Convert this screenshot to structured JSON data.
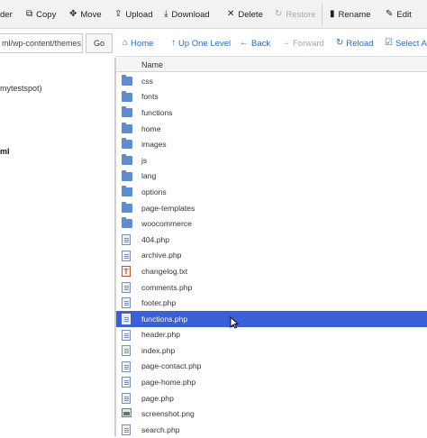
{
  "toolbar": {
    "items": [
      {
        "label": "der",
        "icon": "folder-icon",
        "enabled": true
      },
      {
        "label": "Copy",
        "icon": "copy-icon",
        "enabled": true
      },
      {
        "label": "Move",
        "icon": "move-icon",
        "enabled": true
      },
      {
        "label": "Upload",
        "icon": "upload-icon",
        "enabled": true
      },
      {
        "label": "Download",
        "icon": "download-icon",
        "enabled": true
      },
      {
        "label": "Delete",
        "icon": "delete-icon",
        "enabled": true
      },
      {
        "label": "Restore",
        "icon": "restore-icon",
        "enabled": false
      },
      {
        "label": "Rename",
        "icon": "rename-icon",
        "enabled": true
      },
      {
        "label": "Edit",
        "icon": "edit-icon",
        "enabled": true
      }
    ]
  },
  "path": {
    "value": "ml/wp-content/themes",
    "go_label": "Go"
  },
  "nav": {
    "home": "Home",
    "up_one_level": "Up One Level",
    "back": "Back",
    "forward": "Forward",
    "reload": "Reload",
    "select_all": "Select Al"
  },
  "tree": {
    "line1": "mytestspot)",
    "line2": "ml"
  },
  "filelist": {
    "column_name": "Name",
    "selected_color": "#3a5fd6",
    "rows": [
      {
        "name": "css",
        "type": "folder"
      },
      {
        "name": "fonts",
        "type": "folder"
      },
      {
        "name": "functions",
        "type": "folder"
      },
      {
        "name": "home",
        "type": "folder"
      },
      {
        "name": "images",
        "type": "folder"
      },
      {
        "name": "js",
        "type": "folder"
      },
      {
        "name": "lang",
        "type": "folder"
      },
      {
        "name": "options",
        "type": "folder"
      },
      {
        "name": "page-templates",
        "type": "folder"
      },
      {
        "name": "woocommerce",
        "type": "folder"
      },
      {
        "name": "404.php",
        "type": "php"
      },
      {
        "name": "archive.php",
        "type": "php"
      },
      {
        "name": "changelog.txt",
        "type": "txt"
      },
      {
        "name": "comments.php",
        "type": "php"
      },
      {
        "name": "footer.php",
        "type": "php"
      },
      {
        "name": "functions.php",
        "type": "php",
        "selected": true
      },
      {
        "name": "header.php",
        "type": "php"
      },
      {
        "name": "index.php",
        "type": "php"
      },
      {
        "name": "page-contact.php",
        "type": "php"
      },
      {
        "name": "page-home.php",
        "type": "php"
      },
      {
        "name": "page.php",
        "type": "php"
      },
      {
        "name": "screenshot.png",
        "type": "image"
      },
      {
        "name": "search.php",
        "type": "php"
      }
    ]
  }
}
